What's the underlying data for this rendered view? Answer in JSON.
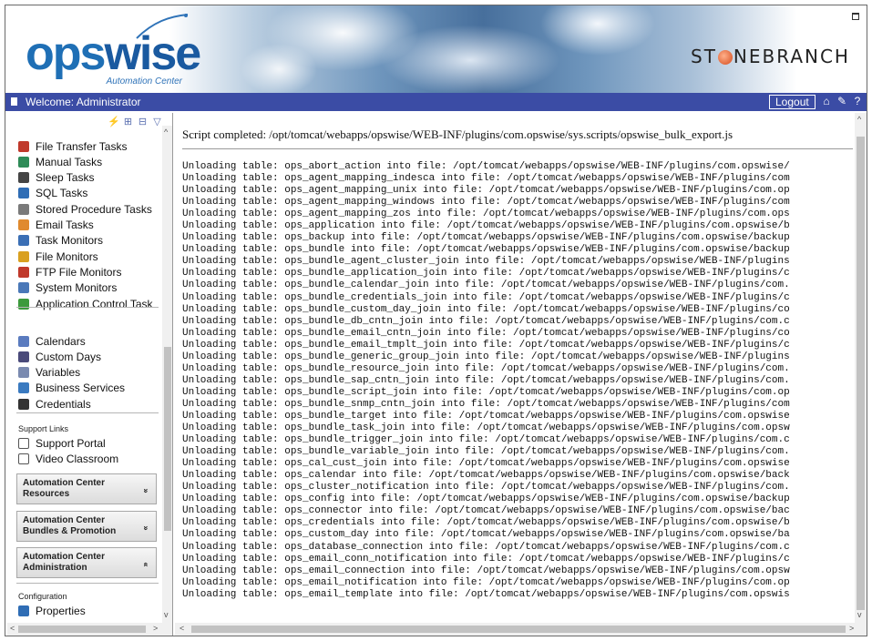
{
  "header": {
    "logo_main": "ops",
    "logo_accent": "wise",
    "logo_sub": "Automation Center",
    "brand": {
      "pre": "ST",
      "post": "NEBRANCH"
    }
  },
  "bluebar": {
    "welcome": "Welcome: Administrator",
    "logout_label": "Logout",
    "icons": [
      "home-icon",
      "tools-icon",
      "help-icon"
    ]
  },
  "sidebar": {
    "toolbar_icons": [
      "lightning-icon",
      "expand-icon",
      "collapse-icon",
      "filter-icon"
    ],
    "tasks": [
      {
        "label": "File Transfer Tasks",
        "icon": "file-transfer-icon",
        "color": "#c0392b"
      },
      {
        "label": "Manual Tasks",
        "icon": "manual-icon",
        "color": "#2e8b57"
      },
      {
        "label": "Sleep Tasks",
        "icon": "sleep-icon",
        "color": "#444444"
      },
      {
        "label": "SQL Tasks",
        "icon": "sql-icon",
        "color": "#2f6db5"
      },
      {
        "label": "Stored Procedure Tasks",
        "icon": "stored-procedure-icon",
        "color": "#7a7a7a"
      },
      {
        "label": "Email Tasks",
        "icon": "email-icon",
        "color": "#e08a2e"
      },
      {
        "label": "Task Monitors",
        "icon": "task-monitor-icon",
        "color": "#3b6fb5"
      },
      {
        "label": "File Monitors",
        "icon": "file-monitor-icon",
        "color": "#d9a020"
      },
      {
        "label": "FTP File Monitors",
        "icon": "ftp-monitor-icon",
        "color": "#c0392b"
      },
      {
        "label": "System Monitors",
        "icon": "system-monitor-icon",
        "color": "#4a78b8"
      },
      {
        "label": "Application Control Task",
        "icon": "application-control-icon",
        "color": "#3c9a3c"
      }
    ],
    "definitions": [
      {
        "label": "Calendars",
        "icon": "calendar-icon",
        "color": "#5a7bbf"
      },
      {
        "label": "Custom Days",
        "icon": "custom-days-icon",
        "color": "#4a4a7a"
      },
      {
        "label": "Variables",
        "icon": "variables-icon",
        "color": "#7a8ab0"
      },
      {
        "label": "Business Services",
        "icon": "business-services-icon",
        "color": "#3a7ac0"
      },
      {
        "label": "Credentials",
        "icon": "credentials-icon",
        "color": "#333333"
      }
    ],
    "support_head": "Support Links",
    "support": [
      {
        "label": "Support Portal",
        "icon": "page-icon"
      },
      {
        "label": "Video Classroom",
        "icon": "page-icon"
      }
    ],
    "panels": [
      {
        "line1": "Automation Center",
        "line2": "Resources",
        "chevron": "»"
      },
      {
        "line1": "Automation Center",
        "line2": "Bundles & Promotion",
        "chevron": "»"
      },
      {
        "line1": "Automation Center",
        "line2": "Administration",
        "chevron": "«"
      }
    ],
    "config_head": "Configuration",
    "config": [
      {
        "label": "Properties",
        "icon": "properties-icon",
        "color": "#2f6db5"
      }
    ]
  },
  "main": {
    "status": "Script completed: /opt/tomcat/webapps/opswise/WEB-INF/plugins/com.opswise/sys.scripts/opswise_bulk_export.js",
    "log": [
      "Unloading table: ops_abort_action into file: /opt/tomcat/webapps/opswise/WEB-INF/plugins/com.opswise/",
      "Unloading table: ops_agent_mapping_indesca into file: /opt/tomcat/webapps/opswise/WEB-INF/plugins/com",
      "Unloading table: ops_agent_mapping_unix into file: /opt/tomcat/webapps/opswise/WEB-INF/plugins/com.op",
      "Unloading table: ops_agent_mapping_windows into file: /opt/tomcat/webapps/opswise/WEB-INF/plugins/com",
      "Unloading table: ops_agent_mapping_zos into file: /opt/tomcat/webapps/opswise/WEB-INF/plugins/com.ops",
      "Unloading table: ops_application into file: /opt/tomcat/webapps/opswise/WEB-INF/plugins/com.opswise/b",
      "Unloading table: ops_backup into file: /opt/tomcat/webapps/opswise/WEB-INF/plugins/com.opswise/backup",
      "Unloading table: ops_bundle into file: /opt/tomcat/webapps/opswise/WEB-INF/plugins/com.opswise/backup",
      "Unloading table: ops_bundle_agent_cluster_join into file: /opt/tomcat/webapps/opswise/WEB-INF/plugins",
      "Unloading table: ops_bundle_application_join into file: /opt/tomcat/webapps/opswise/WEB-INF/plugins/c",
      "Unloading table: ops_bundle_calendar_join into file: /opt/tomcat/webapps/opswise/WEB-INF/plugins/com.",
      "Unloading table: ops_bundle_credentials_join into file: /opt/tomcat/webapps/opswise/WEB-INF/plugins/c",
      "Unloading table: ops_bundle_custom_day_join into file: /opt/tomcat/webapps/opswise/WEB-INF/plugins/co",
      "Unloading table: ops_bundle_db_cntn_join into file: /opt/tomcat/webapps/opswise/WEB-INF/plugins/com.c",
      "Unloading table: ops_bundle_email_cntn_join into file: /opt/tomcat/webapps/opswise/WEB-INF/plugins/co",
      "Unloading table: ops_bundle_email_tmplt_join into file: /opt/tomcat/webapps/opswise/WEB-INF/plugins/c",
      "Unloading table: ops_bundle_generic_group_join into file: /opt/tomcat/webapps/opswise/WEB-INF/plugins",
      "Unloading table: ops_bundle_resource_join into file: /opt/tomcat/webapps/opswise/WEB-INF/plugins/com.",
      "Unloading table: ops_bundle_sap_cntn_join into file: /opt/tomcat/webapps/opswise/WEB-INF/plugins/com.",
      "Unloading table: ops_bundle_script_join into file: /opt/tomcat/webapps/opswise/WEB-INF/plugins/com.op",
      "Unloading table: ops_bundle_snmp_cntn_join into file: /opt/tomcat/webapps/opswise/WEB-INF/plugins/com",
      "Unloading table: ops_bundle_target into file: /opt/tomcat/webapps/opswise/WEB-INF/plugins/com.opswise",
      "Unloading table: ops_bundle_task_join into file: /opt/tomcat/webapps/opswise/WEB-INF/plugins/com.opsw",
      "Unloading table: ops_bundle_trigger_join into file: /opt/tomcat/webapps/opswise/WEB-INF/plugins/com.c",
      "Unloading table: ops_bundle_variable_join into file: /opt/tomcat/webapps/opswise/WEB-INF/plugins/com.",
      "Unloading table: ops_cal_cust_join into file: /opt/tomcat/webapps/opswise/WEB-INF/plugins/com.opswise",
      "Unloading table: ops_calendar into file: /opt/tomcat/webapps/opswise/WEB-INF/plugins/com.opswise/back",
      "Unloading table: ops_cluster_notification into file: /opt/tomcat/webapps/opswise/WEB-INF/plugins/com.",
      "Unloading table: ops_config into file: /opt/tomcat/webapps/opswise/WEB-INF/plugins/com.opswise/backup",
      "Unloading table: ops_connector into file: /opt/tomcat/webapps/opswise/WEB-INF/plugins/com.opswise/bac",
      "Unloading table: ops_credentials into file: /opt/tomcat/webapps/opswise/WEB-INF/plugins/com.opswise/b",
      "Unloading table: ops_custom_day into file: /opt/tomcat/webapps/opswise/WEB-INF/plugins/com.opswise/ba",
      "Unloading table: ops_database_connection into file: /opt/tomcat/webapps/opswise/WEB-INF/plugins/com.c",
      "Unloading table: ops_email_conn_notification into file: /opt/tomcat/webapps/opswise/WEB-INF/plugins/c",
      "Unloading table: ops_email_connection into file: /opt/tomcat/webapps/opswise/WEB-INF/plugins/com.opsw",
      "Unloading table: ops_email_notification into file: /opt/tomcat/webapps/opswise/WEB-INF/plugins/com.op",
      "Unloading table: ops_email_template into file: /opt/tomcat/webapps/opswise/WEB-INF/plugins/com.opswis"
    ]
  },
  "colors": {
    "bluebar": "#3b4ca5",
    "logo_blue": "#1f6fb5",
    "brand_orange": "#d54a1c"
  }
}
